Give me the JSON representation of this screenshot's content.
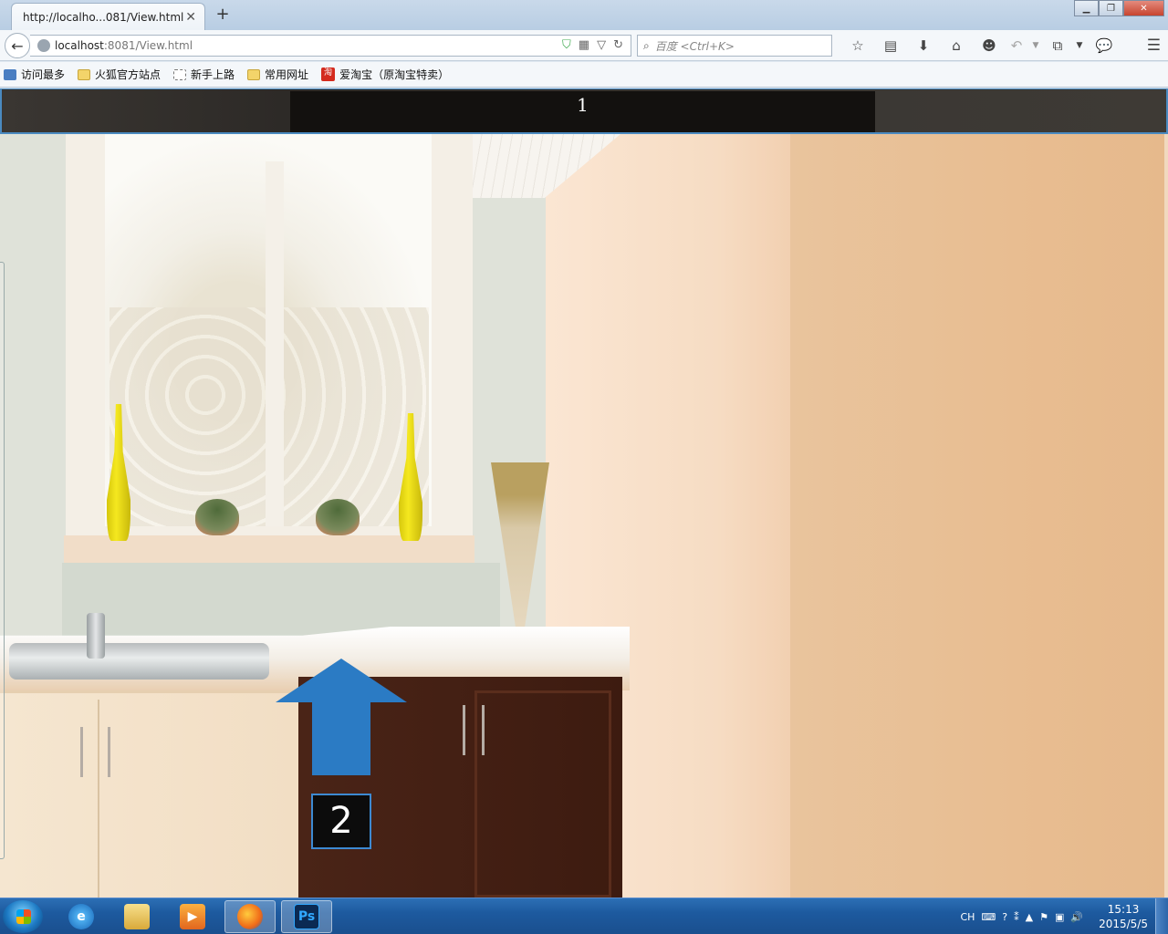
{
  "browser": {
    "tab": {
      "title": "http://localho...081/View.html",
      "close": "✕"
    },
    "new_tab": "+",
    "window_buttons": {
      "minimize": "▁",
      "maximize": "❐",
      "close": "✕"
    },
    "url": {
      "host": "localhost",
      "rest": ":8081/View.html"
    },
    "search_placeholder": "百度 <Ctrl+K>",
    "toolbar_icons": [
      "star-icon",
      "reading-list-icon",
      "download-icon",
      "home-icon",
      "chat-icon",
      "undo-icon",
      "dropdown-icon",
      "crop-icon",
      "dropdown-icon",
      "speech-icon"
    ],
    "bookmarks": [
      {
        "label": "访问最多",
        "icon": "blue"
      },
      {
        "label": "火狐官方站点",
        "icon": "folder"
      },
      {
        "label": "新手上路",
        "icon": "dashed"
      },
      {
        "label": "常用网址",
        "icon": "folder"
      },
      {
        "label": "爱淘宝（原淘宝特卖）",
        "icon": "taobao",
        "icon_text": "淘"
      }
    ]
  },
  "page": {
    "label_top": "1",
    "label_marker": "2",
    "accent_color": "#2b7bc4"
  },
  "taskbar": {
    "apps": [
      {
        "name": "internet-explorer",
        "glyph": "e",
        "active": false
      },
      {
        "name": "file-explorer",
        "glyph": "",
        "active": false
      },
      {
        "name": "media-player",
        "glyph": "▶",
        "active": false
      },
      {
        "name": "firefox",
        "glyph": "",
        "active": true
      },
      {
        "name": "photoshop",
        "glyph": "Ps",
        "active": true
      }
    ],
    "tray": {
      "language": "CH",
      "time": "15:13",
      "date": "2015/5/5"
    }
  }
}
